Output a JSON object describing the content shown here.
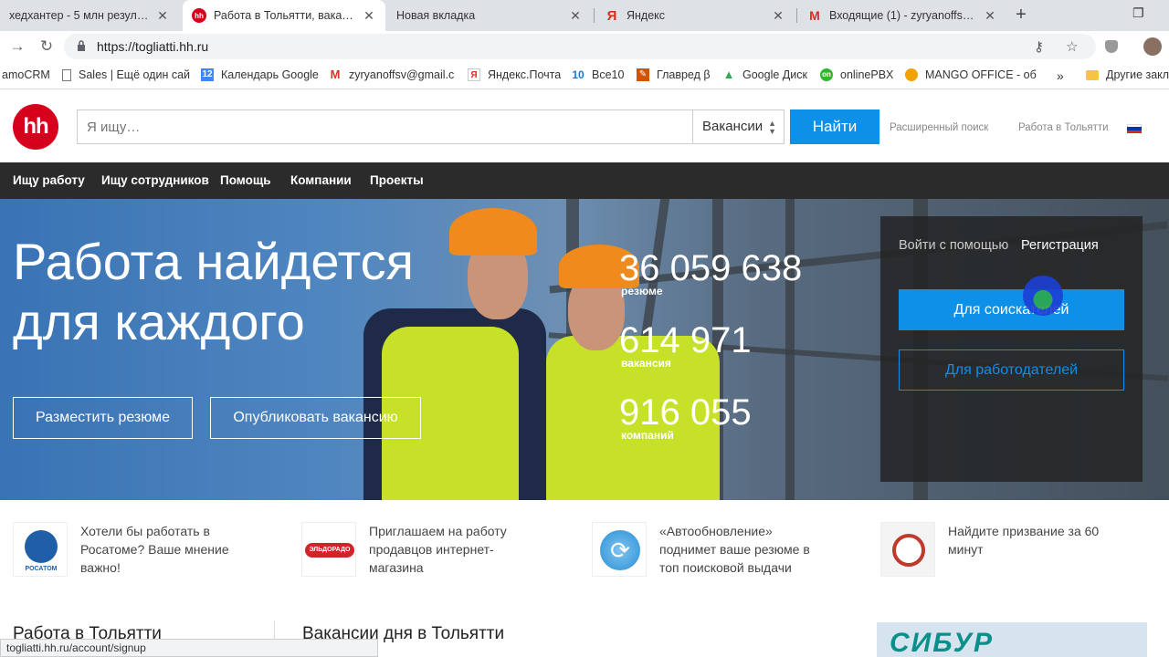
{
  "tabs": [
    {
      "title": "хедхантер - 5 млн результато...",
      "active": false
    },
    {
      "title": "Работа в Тольятти, ваканси...",
      "active": true
    },
    {
      "title": "Новая вкладка",
      "active": false
    },
    {
      "title": "Яндекс",
      "active": false
    },
    {
      "title": "Входящие (1) - zyryanoffsv@g...",
      "active": false
    }
  ],
  "address_bar": {
    "url": "https://togliatti.hh.ru"
  },
  "bookmarks": [
    {
      "label": "amoCRM",
      "icon": "amocrm-icon"
    },
    {
      "label": "Sales | Ещё один сай",
      "icon": "page-icon"
    },
    {
      "label": "Календарь Google",
      "icon": "calendar-icon"
    },
    {
      "label": "zyryanoffsv@gmail.c",
      "icon": "gmail-icon"
    },
    {
      "label": "Яндекс.Почта",
      "icon": "yandex-mail-icon"
    },
    {
      "label": "Все10",
      "icon": "vse10-icon"
    },
    {
      "label": "Главред β",
      "icon": "glavred-icon"
    },
    {
      "label": "Google Диск",
      "icon": "drive-icon"
    },
    {
      "label": "onlinePBX",
      "icon": "onlinepbx-icon"
    },
    {
      "label": "MANGO OFFICE - об",
      "icon": "mango-icon"
    },
    {
      "label": "Другие закл",
      "icon": "folder-icon"
    }
  ],
  "header": {
    "logo_text": "hh",
    "search_placeholder": "Я ищу…",
    "search_type": "Вакансии",
    "search_button": "Найти",
    "advanced_search": "Расширенный поиск",
    "city_link": "Работа в Тольятти"
  },
  "nav": [
    "Ищу работу",
    "Ищу сотрудников",
    "Помощь",
    "Компании",
    "Проекты"
  ],
  "hero": {
    "title_line1": "Работа найдется",
    "title_line2": "для каждого",
    "post_resume": "Разместить резюме",
    "post_vacancy": "Опубликовать вакансию",
    "stats": [
      {
        "value": "36 059 638",
        "label": "резюме"
      },
      {
        "value": "614 971",
        "label": "вакансия"
      },
      {
        "value": "916 055",
        "label": "компаний"
      }
    ],
    "login": {
      "login_with": "Войти с помощью",
      "register": "Регистрация",
      "for_seekers": "Для соискателей",
      "for_employers": "Для работодателей"
    }
  },
  "promos": [
    {
      "text": "Хотели бы работать в Росатоме? Ваше мнение важно!",
      "logo": "РОСАТОМ"
    },
    {
      "text": "Приглашаем на работу продавцов интернет-магазина",
      "logo": "ЭЛЬДОРАДО"
    },
    {
      "text": "«Автообновление» поднимет ваше резюме в топ поисковой выдачи",
      "logo": ""
    },
    {
      "text": "Найдите призвание за 60 минут",
      "logo": ""
    }
  ],
  "sections": {
    "left_title": "Работа в Тольятти",
    "center_title": "Вакансии дня в Тольятти",
    "ad_logo": "СИБУР"
  },
  "status_url": "togliatti.hh.ru/account/signup",
  "colors": {
    "brand_red": "#d6001c",
    "accent_blue": "#0d90e8",
    "nav_bg": "#2b2b2b"
  }
}
